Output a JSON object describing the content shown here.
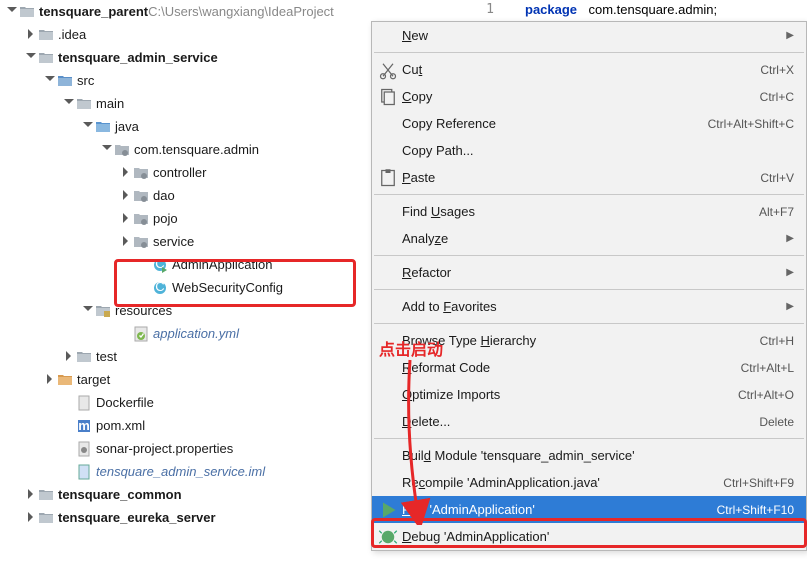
{
  "project": {
    "root_name": "tensquare_parent",
    "root_path": "C:\\Users\\wangxiang\\IdeaProject"
  },
  "tree": [
    {
      "indent": 0,
      "arrow": "open",
      "icon": "folder",
      "label": "tensquare_parent",
      "bold": true,
      "path": true
    },
    {
      "indent": 1,
      "arrow": "closed",
      "icon": "folder",
      "label": ".idea"
    },
    {
      "indent": 1,
      "arrow": "open",
      "icon": "folder",
      "label": "tensquare_admin_service",
      "bold": true
    },
    {
      "indent": 2,
      "arrow": "open",
      "icon": "folder-src",
      "label": "src"
    },
    {
      "indent": 3,
      "arrow": "open",
      "icon": "folder",
      "label": "main"
    },
    {
      "indent": 4,
      "arrow": "open",
      "icon": "folder-blue",
      "label": "java"
    },
    {
      "indent": 5,
      "arrow": "open",
      "icon": "package",
      "label": "com.tensquare.admin"
    },
    {
      "indent": 6,
      "arrow": "closed",
      "icon": "package",
      "label": "controller"
    },
    {
      "indent": 6,
      "arrow": "closed",
      "icon": "package",
      "label": "dao"
    },
    {
      "indent": 6,
      "arrow": "closed",
      "icon": "package",
      "label": "pojo"
    },
    {
      "indent": 6,
      "arrow": "closed",
      "icon": "package",
      "label": "service",
      "box_top": true
    },
    {
      "indent": 7,
      "arrow": "none",
      "icon": "class-run",
      "label": "AdminApplication",
      "box_bottom": true
    },
    {
      "indent": 7,
      "arrow": "none",
      "icon": "class",
      "label": "WebSecurityConfig"
    },
    {
      "indent": 4,
      "arrow": "open",
      "icon": "folder-res",
      "label": "resources"
    },
    {
      "indent": 6,
      "arrow": "none",
      "icon": "yml",
      "label": "application.yml",
      "blue": true
    },
    {
      "indent": 3,
      "arrow": "closed",
      "icon": "folder",
      "label": "test"
    },
    {
      "indent": 2,
      "arrow": "closed",
      "icon": "folder-target",
      "label": "target"
    },
    {
      "indent": 3,
      "arrow": "none",
      "icon": "file",
      "label": "Dockerfile"
    },
    {
      "indent": 3,
      "arrow": "none",
      "icon": "pom",
      "label": "pom.xml"
    },
    {
      "indent": 3,
      "arrow": "none",
      "icon": "file-gear",
      "label": "sonar-project.properties"
    },
    {
      "indent": 3,
      "arrow": "none",
      "icon": "file-blue",
      "label": "tensquare_admin_service.iml",
      "blue": true
    },
    {
      "indent": 1,
      "arrow": "closed",
      "icon": "folder",
      "label": "tensquare_common",
      "bold": true
    },
    {
      "indent": 1,
      "arrow": "closed",
      "icon": "folder",
      "label": "tensquare_eureka_server",
      "bold": true
    }
  ],
  "editor": {
    "line_no": "1",
    "package_kw": "package",
    "package_name": "com.tensquare.admin;"
  },
  "menu": [
    {
      "type": "item",
      "label": "New",
      "ul": "N",
      "arrow": true
    },
    {
      "type": "sep"
    },
    {
      "type": "item",
      "icon": "cut",
      "label": "Cut",
      "ul": "t",
      "shortcut": "Ctrl+X"
    },
    {
      "type": "item",
      "icon": "copy",
      "label": "Copy",
      "ul": "C",
      "shortcut": "Ctrl+C"
    },
    {
      "type": "item",
      "label": "Copy Reference",
      "shortcut": "Ctrl+Alt+Shift+C"
    },
    {
      "type": "item",
      "label": "Copy Path..."
    },
    {
      "type": "item",
      "icon": "paste",
      "label": "Paste",
      "ul": "P",
      "shortcut": "Ctrl+V"
    },
    {
      "type": "sep"
    },
    {
      "type": "item",
      "label": "Find Usages",
      "ul": "U",
      "shortcut": "Alt+F7"
    },
    {
      "type": "item",
      "label": "Analyze",
      "ul": "z",
      "arrow": true
    },
    {
      "type": "sep"
    },
    {
      "type": "item",
      "label": "Refactor",
      "ul": "R",
      "arrow": true
    },
    {
      "type": "sep"
    },
    {
      "type": "item",
      "label": "Add to Favorites",
      "ul": "F",
      "arrow": true
    },
    {
      "type": "sep"
    },
    {
      "type": "item",
      "label": "Browse Type Hierarchy",
      "ul": "H",
      "shortcut": "Ctrl+H"
    },
    {
      "type": "item",
      "label": "Reformat Code",
      "ul": "R",
      "shortcut": "Ctrl+Alt+L"
    },
    {
      "type": "item",
      "label": "Optimize Imports",
      "ul": "O",
      "shortcut": "Ctrl+Alt+O"
    },
    {
      "type": "item",
      "label": "Delete...",
      "ul": "D",
      "shortcut": "Delete"
    },
    {
      "type": "sep"
    },
    {
      "type": "item",
      "label": "Build Module 'tensquare_admin_service'",
      "ul": "d"
    },
    {
      "type": "item",
      "label": "Recompile 'AdminApplication.java'",
      "ul": "c",
      "shortcut": "Ctrl+Shift+F9"
    },
    {
      "type": "item",
      "icon": "run",
      "label": "Run 'AdminApplication'",
      "ul": "R",
      "shortcut": "Ctrl+Shift+F10",
      "selected": true
    },
    {
      "type": "item",
      "icon": "debug",
      "label": "Debug 'AdminApplication'",
      "ul": "D"
    }
  ],
  "annotation": {
    "text": "点击启动"
  }
}
